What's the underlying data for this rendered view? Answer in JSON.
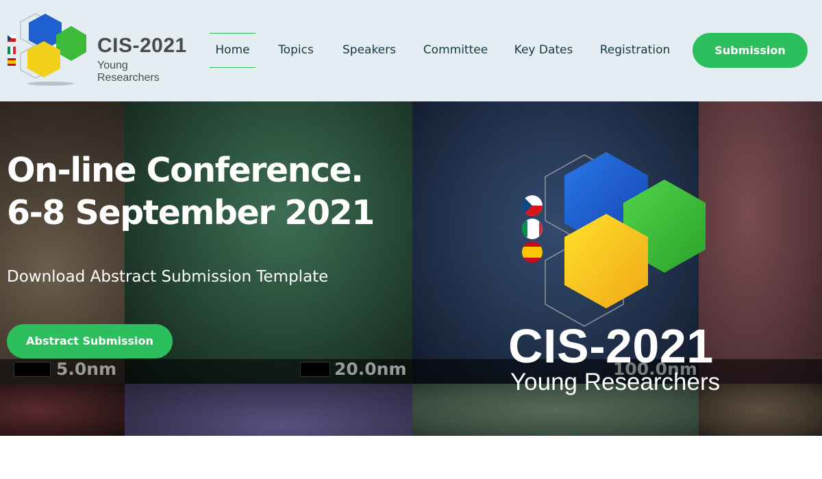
{
  "header": {
    "logo": {
      "title": "CIS-2021",
      "subtitle": "Young Researchers"
    },
    "nav": [
      {
        "label": "Home",
        "active": true
      },
      {
        "label": "Topics",
        "active": false
      },
      {
        "label": "Speakers",
        "active": false
      },
      {
        "label": "Committee",
        "active": false
      },
      {
        "label": "Key Dates",
        "active": false
      },
      {
        "label": "Registration",
        "active": false
      }
    ],
    "submission_label": "Submission"
  },
  "hero": {
    "title_line1": "On-line Conference.",
    "title_line2": "6-8 September 2021",
    "template_link": "Download Abstract Submission Template",
    "abstract_button": "Abstract Submission",
    "scale_labels": [
      "5.0nm",
      "20.0nm",
      "100.0nm"
    ],
    "big_logo": {
      "title": "CIS-2021",
      "subtitle": "Young Researchers"
    }
  },
  "colors": {
    "accent_green": "#2dbf5d",
    "header_bg": "#e3edf2",
    "nav_text": "#16364a",
    "hex_blue": "#1f5fd0",
    "hex_green": "#3cba3a",
    "hex_yellow": "#f2cf18"
  },
  "icons": {
    "flag_czech": "flag-czech-icon",
    "flag_italy": "flag-italy-icon",
    "flag_spain": "flag-spain-icon"
  }
}
